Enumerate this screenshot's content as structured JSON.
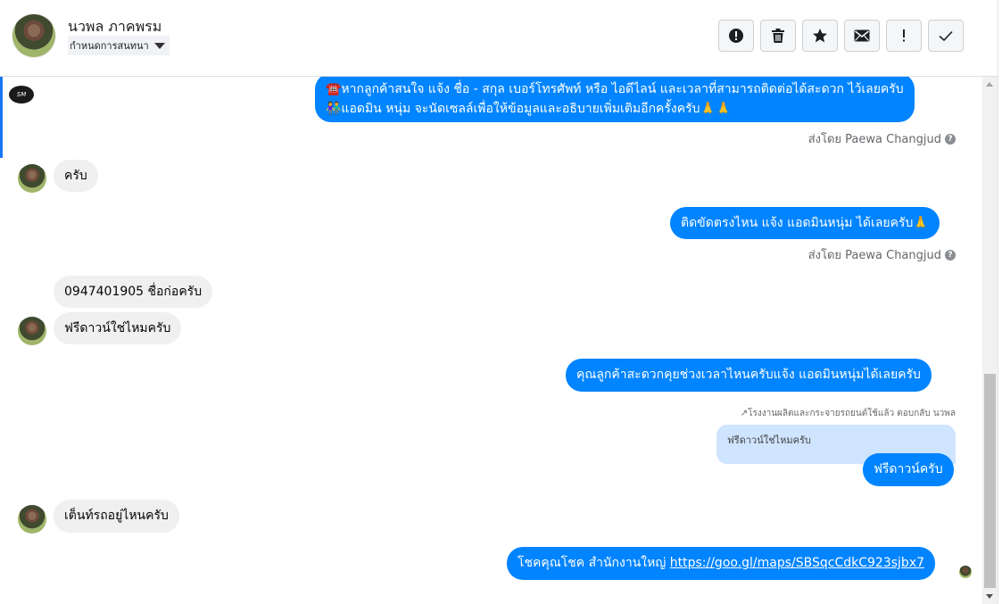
{
  "header": {
    "contact_name": "นวพล ภาคพรม",
    "conversation_label": "กำหนดการสนทนา",
    "actions": [
      "alert-circle-icon",
      "trash-icon",
      "star-icon",
      "mail-icon",
      "exclamation-icon",
      "check-icon"
    ]
  },
  "page_logo_text": "SM",
  "messages": [
    {
      "direction": "out",
      "lines": [
        "☎️หากลูกค้าสนใจ แจ้ง ชื่อ - สกุล เบอร์โทรศัพท์ หรือ ไอดีไลน์ และเวลาที่สามารถติดต่อได้สะดวก ไว้เลยครับ",
        "👫แอดมิน หนุ่ม จะนัดเซลล์เพื่อให้ข้อมูลและอธิบายเพิ่มเติมอีกครั้งครับ🙏🙏"
      ]
    },
    {
      "direction": "in",
      "text": "ครับ"
    },
    {
      "direction": "out",
      "text": "ติดขัดตรงไหน แจ้ง แอดมินหนุ่ม ได้เลยครับ🙏"
    },
    {
      "direction": "in",
      "text": "0947401905 ชื่อก่อครับ"
    },
    {
      "direction": "in",
      "text": "ฟรีดาวน์ใช่ไหมครับ"
    },
    {
      "direction": "out",
      "text": "คุณลูกค้าสะดวกคุยช่วงเวลาไหนครับแจ้ง แอดมินหนุ่มได้เลยครับ"
    },
    {
      "direction": "out",
      "text": "ฟรีดาวน์ครับ"
    },
    {
      "direction": "in",
      "text": "เต็นท์รถอยู่ไหนครับ"
    },
    {
      "direction": "out",
      "text_prefix": "โชคคุณโชค สำนักงานใหญ่ ",
      "link": "https://goo.gl/maps/SBSqcCdkC923sjbx7"
    }
  ],
  "sent_by": "ส่งโดย Paewa Changjud",
  "reply_note": "↗โรงงานผลิตและกระจายรถยนต์ใช้แล้ว ตอบกลับ นวพล",
  "quoted_text": "ฟรีดาวน์ใช่ไหมครับ",
  "colors": {
    "outgoing_bubble": "#0084ff",
    "incoming_bubble": "#f0f0f0",
    "accent": "#1877f2"
  }
}
